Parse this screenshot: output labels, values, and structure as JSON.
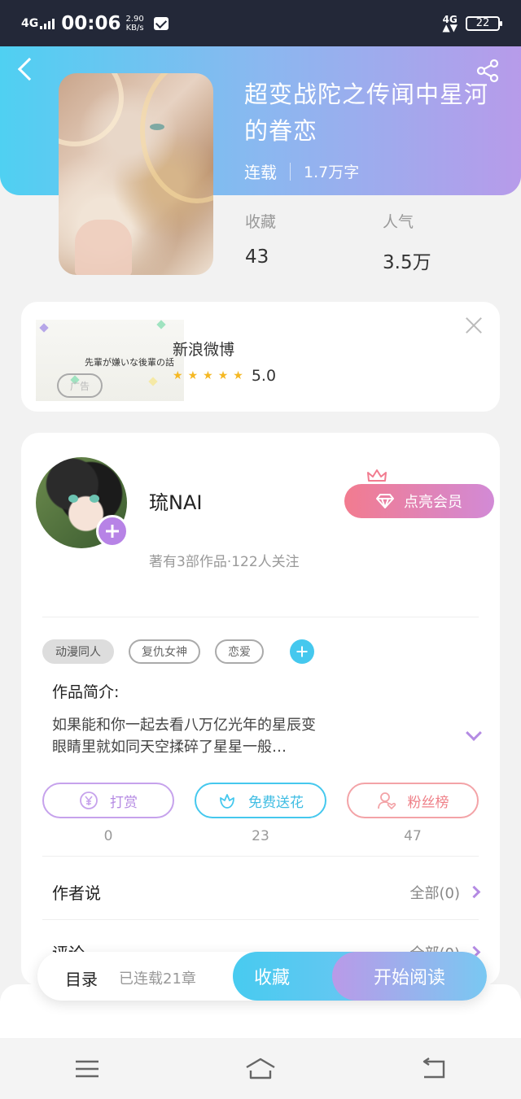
{
  "status_bar": {
    "network": "4G",
    "time": "00:06",
    "speed_value": "2.90",
    "speed_unit": "KB/s",
    "network_right": "4G",
    "battery": "22"
  },
  "book": {
    "title": "超变战陀之传闻中星河的眷恋",
    "status": "连载",
    "word_count": "1.7万字",
    "stats": {
      "favorites_label": "收藏",
      "favorites_value": "43",
      "popularity_label": "人气",
      "popularity_value": "3.5万"
    }
  },
  "ad": {
    "image_text": "先輩が嫌いな後輩の話",
    "badge": "广告",
    "name": "新浪微博",
    "rating": "5.0",
    "stars": 5
  },
  "author": {
    "name": "琉NAI",
    "info": "著有3部作品·122人关注",
    "vip_label": "点亮会员"
  },
  "tags": [
    "动漫同人",
    "复仇女神",
    "恋爱"
  ],
  "intro": {
    "label": "作品简介:",
    "line1": "如果能和你一起去看八万亿光年的星辰变",
    "line2": "眼睛里就如同天空揉碎了星星一般…"
  },
  "actions": [
    {
      "label": "打赏",
      "count": "0"
    },
    {
      "label": "免费送花",
      "count": "23"
    },
    {
      "label": "粉丝榜",
      "count": "47"
    }
  ],
  "sections": {
    "author_says": {
      "label": "作者说",
      "link": "全部(0)"
    },
    "comments": {
      "label": "评论",
      "link": "全部(0)"
    }
  },
  "bottom_bar": {
    "toc": "目录",
    "chapters": "已连载21章",
    "favorite": "收藏",
    "read": "开始阅读"
  },
  "colors": {
    "header_start": "#4fd0f2",
    "header_end": "#b79bea",
    "accent_purple": "#b783e6",
    "accent_cyan": "#45c8ee",
    "accent_pink": "#ef7f87"
  }
}
